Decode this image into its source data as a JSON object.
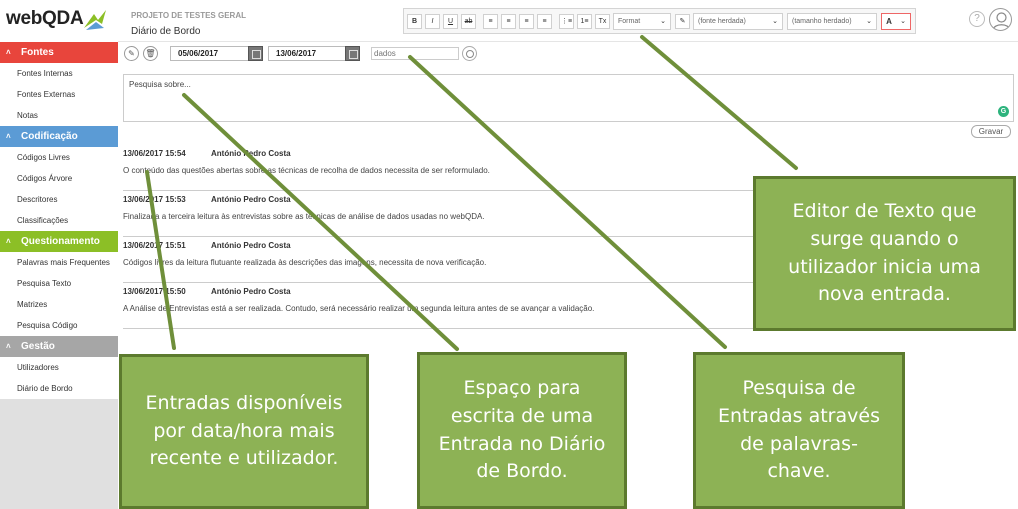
{
  "app": {
    "logo_text": "webQDA"
  },
  "header": {
    "project": "PROJETO DE TESTES GERAL",
    "page_title": "Diário de Bordo",
    "toolbar": {
      "buttons": [
        "B",
        "I",
        "U",
        "ab",
        "≡",
        "≡",
        "≡",
        "≡",
        "⋮≡",
        "1≡",
        "Tx"
      ],
      "format_label": "Format",
      "font_label": "(fonte herdada)",
      "size_label": "(tamanho herdado)",
      "color_label": "A"
    }
  },
  "sidebar": {
    "sections": [
      {
        "title": "Fontes",
        "color": "#e8453c",
        "items": [
          "Fontes Internas",
          "Fontes Externas",
          "Notas"
        ]
      },
      {
        "title": "Codificação",
        "color": "#5b9bd5",
        "items": [
          "Códigos Livres",
          "Códigos Árvore",
          "Descritores",
          "Classificações"
        ]
      },
      {
        "title": "Questionamento",
        "color": "#8cbf26",
        "items": [
          "Palavras mais Frequentes",
          "Pesquisa Texto",
          "Matrizes",
          "Pesquisa Código"
        ]
      },
      {
        "title": "Gestão",
        "color": "#a6a6a6",
        "items": [
          "Utilizadores",
          "Diário de Bordo"
        ]
      }
    ]
  },
  "filters": {
    "date_from": "05/06/2017",
    "date_to": "13/06/2017",
    "search_placeholder": "dados"
  },
  "editor": {
    "placeholder": "Pesquisa sobre...",
    "save_label": "Gravar"
  },
  "entries": [
    {
      "datetime": "13/06/2017 15:54",
      "author": "António Pedro Costa",
      "text": "O conteúdo das questões abertas sobre as técnicas de recolha de dados necessita de ser reformulado."
    },
    {
      "datetime": "13/06/2017 15:53",
      "author": "António Pedro Costa",
      "text": "Finalizada a terceira leitura às entrevistas sobre as técnicas de análise de dados usadas no webQDA."
    },
    {
      "datetime": "13/06/2017 15:51",
      "author": "António Pedro Costa",
      "text": "Códigos livres da leitura flutuante realizada às descrições das imagens, necessita de nova verificação."
    },
    {
      "datetime": "13/06/2017 15:50",
      "author": "António Pedro Costa",
      "text": "A Análise de Entrevistas está a ser realizada. Contudo, será necessário realizar um segunda leitura antes de se avançar a validação."
    }
  ],
  "annotations": {
    "editor": "Editor de Texto que surge quando o utilizador inicia uma nova entrada.",
    "entries": "Entradas disponíveis por data/hora mais recente e utilizador.",
    "writing": "Espaço para escrita de uma Entrada no Diário de Bordo.",
    "search": "Pesquisa de Entradas através de palavras-chave.",
    "color": "#8db255"
  }
}
